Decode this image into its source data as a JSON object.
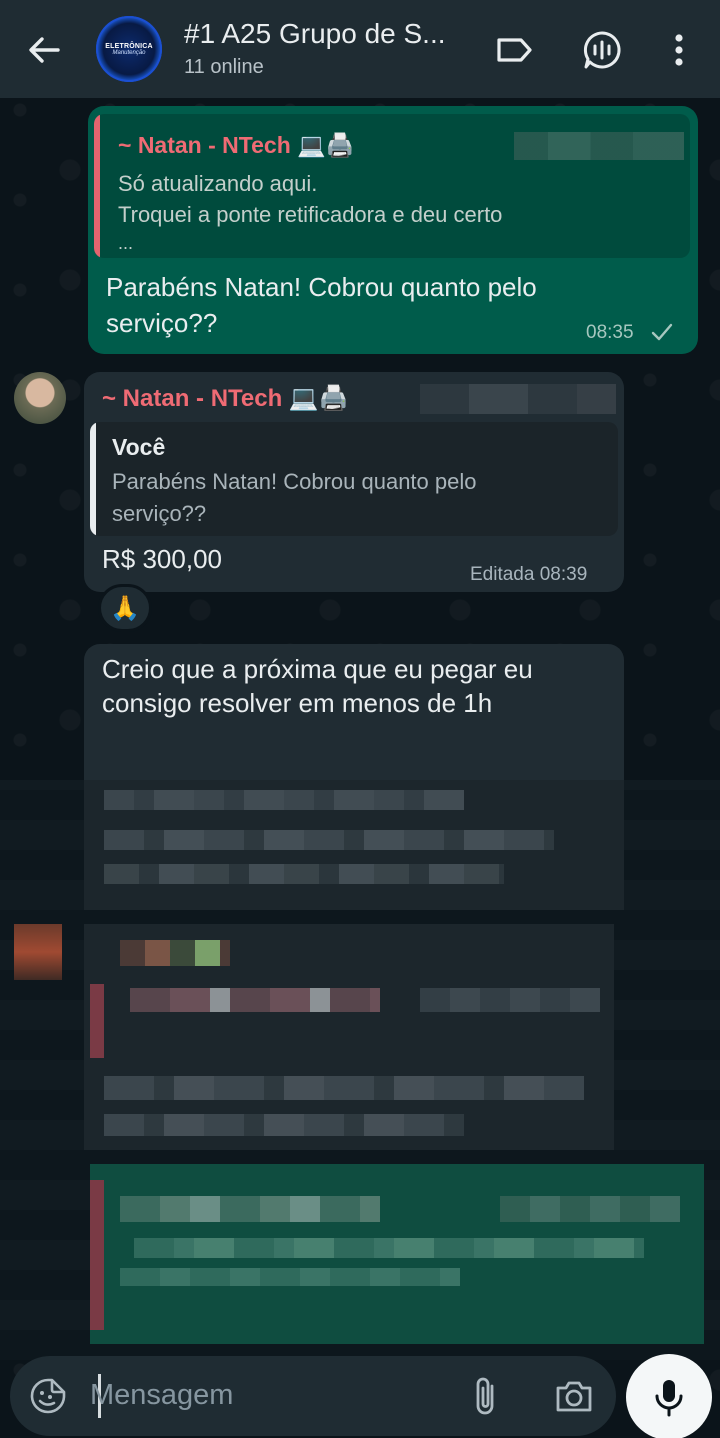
{
  "header": {
    "title": "#1 A25 Grupo de S...",
    "subtitle": "11 online",
    "avatar_line1": "ELETRÔNICA",
    "avatar_line2": "Manutenção",
    "icons": [
      "back-arrow-icon",
      "label-icon",
      "voice-chat-icon",
      "more-vert-icon"
    ]
  },
  "messages": [
    {
      "type": "outgoing",
      "quote": {
        "author": "~ Natan - NTech 💻🖨️",
        "lines": [
          "Só atualizando aqui.",
          "Troquei a ponte retificadora e deu certo",
          "..."
        ]
      },
      "text_line1": "Parabéns Natan! Cobrou quanto pelo",
      "text_line2": "serviço??",
      "time": "08:35",
      "status_icon": "check-icon"
    },
    {
      "type": "incoming",
      "sender": "~ Natan - NTech 💻🖨️",
      "quote": {
        "author": "Você",
        "line1": "Parabéns Natan! Cobrou quanto pelo",
        "line2": "serviço??"
      },
      "text": "R$ 300,00",
      "time": "Editada 08:39",
      "reaction": "🙏"
    },
    {
      "type": "incoming",
      "text_line1": "Creio que a próxima que eu pegar eu",
      "text_line2": "consigo resolver em menos de 1h"
    }
  ],
  "composer": {
    "placeholder": "Mensagem",
    "icons": [
      "emoji-sticker-icon",
      "attach-icon",
      "camera-icon",
      "mic-icon"
    ]
  },
  "colors": {
    "header_bg": "#1f2c33",
    "outgoing_bubble": "#005c4b",
    "incoming_bubble": "#202c33",
    "sender_name": "#ef6b74",
    "quote_bar_pink": "#e5646f",
    "quote_bar_white": "#e9edef"
  }
}
